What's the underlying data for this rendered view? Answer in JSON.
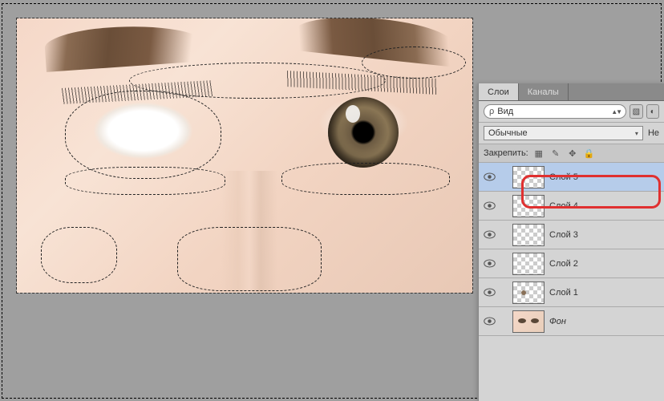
{
  "tabs": {
    "layers": "Слои",
    "channels": "Каналы"
  },
  "search": {
    "label": "Вид"
  },
  "blend": {
    "mode": "Обычные",
    "opacity_lbl": "Не"
  },
  "lock": {
    "label": "Закрепить:"
  },
  "layers": [
    {
      "name": "Слой 5",
      "thumb": "checker",
      "selected": true,
      "italic": false
    },
    {
      "name": "Слой 4",
      "thumb": "checker",
      "selected": false,
      "italic": false
    },
    {
      "name": "Слой 3",
      "thumb": "checker",
      "selected": false,
      "italic": false
    },
    {
      "name": "Слой 2",
      "thumb": "checker",
      "selected": false,
      "italic": false
    },
    {
      "name": "Слой 1",
      "thumb": "checker dot",
      "selected": false,
      "italic": false
    },
    {
      "name": "Фон",
      "thumb": "face-thumb",
      "selected": false,
      "italic": true
    }
  ]
}
